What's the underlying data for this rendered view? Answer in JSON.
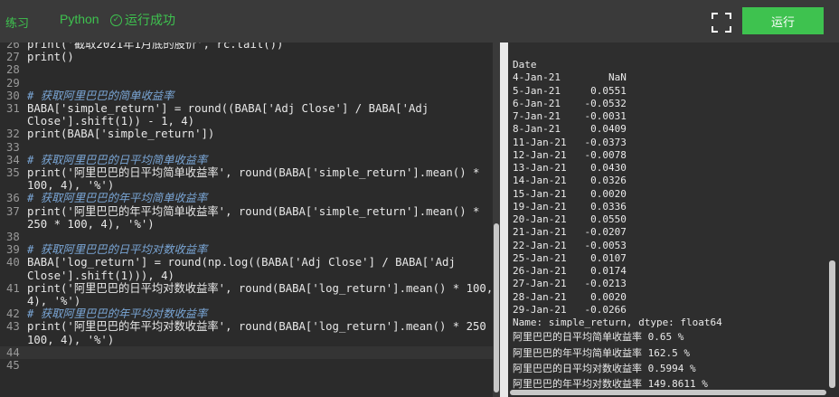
{
  "toolbar": {
    "tab_label": "练习",
    "language": "Python",
    "status": "运行成功",
    "run_label": "运行",
    "accent_color": "#3ec24f"
  },
  "editor": {
    "lines": [
      {
        "ln": "26",
        "code": "print('截取2021年1月底的股价', rc.tail())",
        "type": "code"
      },
      {
        "ln": "27",
        "code": "print()",
        "type": "code"
      },
      {
        "ln": "28",
        "code": "",
        "type": "code"
      },
      {
        "ln": "29",
        "code": "",
        "type": "code"
      },
      {
        "ln": "30",
        "code": "# 获取阿里巴巴的简单收益率",
        "type": "comment"
      },
      {
        "ln": "31",
        "code": "BABA['simple_return'] = round((BABA['Adj Close'] / BABA['Adj",
        "type": "code"
      },
      {
        "ln": "",
        "code": "Close'].shift(1)) - 1, 4)",
        "type": "cont"
      },
      {
        "ln": "32",
        "code": "print(BABA['simple_return'])",
        "type": "code"
      },
      {
        "ln": "33",
        "code": "",
        "type": "code"
      },
      {
        "ln": "34",
        "code": "# 获取阿里巴巴的日平均简单收益率",
        "type": "comment"
      },
      {
        "ln": "35",
        "code": "print('阿里巴巴的日平均简单收益率', round(BABA['simple_return'].mean() *",
        "type": "code"
      },
      {
        "ln": "",
        "code": "100, 4), '%')",
        "type": "cont"
      },
      {
        "ln": "36",
        "code": "# 获取阿里巴巴的年平均简单收益率",
        "type": "comment"
      },
      {
        "ln": "37",
        "code": "print('阿里巴巴的年平均简单收益率', round(BABA['simple_return'].mean() *",
        "type": "code"
      },
      {
        "ln": "",
        "code": "250 * 100, 4), '%')",
        "type": "cont"
      },
      {
        "ln": "38",
        "code": "",
        "type": "code"
      },
      {
        "ln": "39",
        "code": "# 获取阿里巴巴的日平均对数收益率",
        "type": "comment"
      },
      {
        "ln": "40",
        "code": "BABA['log_return'] = round(np.log((BABA['Adj Close'] / BABA['Adj",
        "type": "code"
      },
      {
        "ln": "",
        "code": "Close'].shift(1))), 4)",
        "type": "cont"
      },
      {
        "ln": "41",
        "code": "print('阿里巴巴的日平均对数收益率', round(BABA['log_return'].mean() * 100,",
        "type": "code"
      },
      {
        "ln": "",
        "code": "4), '%')",
        "type": "cont"
      },
      {
        "ln": "42",
        "code": "# 获取阿里巴巴的年平均对数收益率",
        "type": "comment"
      },
      {
        "ln": "43",
        "code": "print('阿里巴巴的年平均对数收益率', round(BABA['log_return'].mean() * 250 *",
        "type": "code"
      },
      {
        "ln": "",
        "code": "100, 4), '%')",
        "type": "cont"
      },
      {
        "ln": "44",
        "code": "",
        "type": "current"
      },
      {
        "ln": "45",
        "code": "",
        "type": "code"
      }
    ]
  },
  "output": {
    "lines": [
      "Date",
      "4-Jan-21        NaN",
      "5-Jan-21     0.0551",
      "6-Jan-21    -0.0532",
      "7-Jan-21    -0.0031",
      "8-Jan-21     0.0409",
      "11-Jan-21   -0.0373",
      "12-Jan-21   -0.0078",
      "13-Jan-21    0.0430",
      "14-Jan-21    0.0326",
      "15-Jan-21    0.0020",
      "19-Jan-21    0.0336",
      "20-Jan-21    0.0550",
      "21-Jan-21   -0.0207",
      "22-Jan-21   -0.0053",
      "25-Jan-21    0.0107",
      "26-Jan-21    0.0174",
      "27-Jan-21   -0.0213",
      "28-Jan-21    0.0020",
      "29-Jan-21   -0.0266",
      "Name: simple_return, dtype: float64"
    ],
    "results": [
      "阿里巴巴的日平均简单收益率 0.65 %",
      "阿里巴巴的年平均简单收益率 162.5 %",
      "阿里巴巴的日平均对数收益率 0.5994 %",
      "阿里巴巴的年平均对数收益率 149.8611 %"
    ]
  }
}
